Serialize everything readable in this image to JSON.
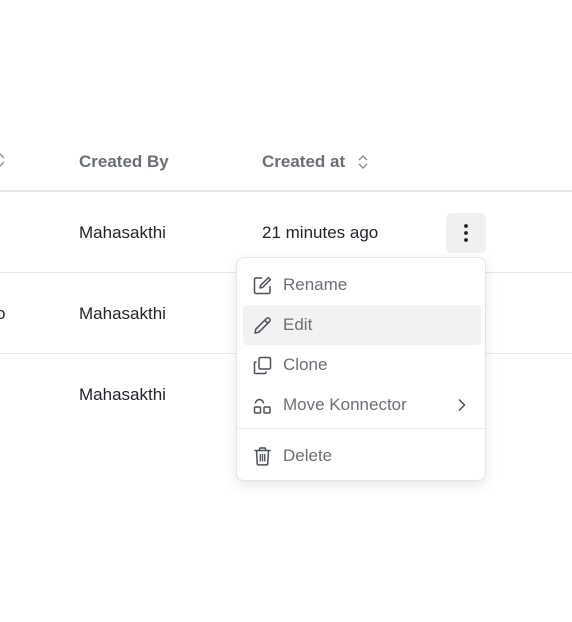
{
  "table": {
    "columns": {
      "name_partial": "",
      "created_by": "Created By",
      "created_at": "Created at"
    },
    "rows": [
      {
        "name_partial": "",
        "created_by": "Mahasakthi",
        "created_at": "21 minutes ago"
      },
      {
        "name_partial": "o",
        "created_by": "Mahasakthi",
        "created_at": ""
      },
      {
        "name_partial": "",
        "created_by": "Mahasakthi",
        "created_at": ""
      }
    ]
  },
  "menu": {
    "items": [
      {
        "label": "Rename",
        "icon": "rename-icon"
      },
      {
        "label": "Edit",
        "icon": "pencil-icon",
        "active": true
      },
      {
        "label": "Clone",
        "icon": "clone-icon"
      },
      {
        "label": "Move Konnector",
        "icon": "move-konnector-icon",
        "has_submenu": true
      },
      {
        "label": "Delete",
        "icon": "trash-icon"
      }
    ]
  },
  "colors": {
    "header_text": "#6b6f76",
    "body_text": "#1f2328",
    "menu_text": "#6b6f76",
    "active_bg": "#f2f2f3",
    "border": "#e5e7eb"
  }
}
